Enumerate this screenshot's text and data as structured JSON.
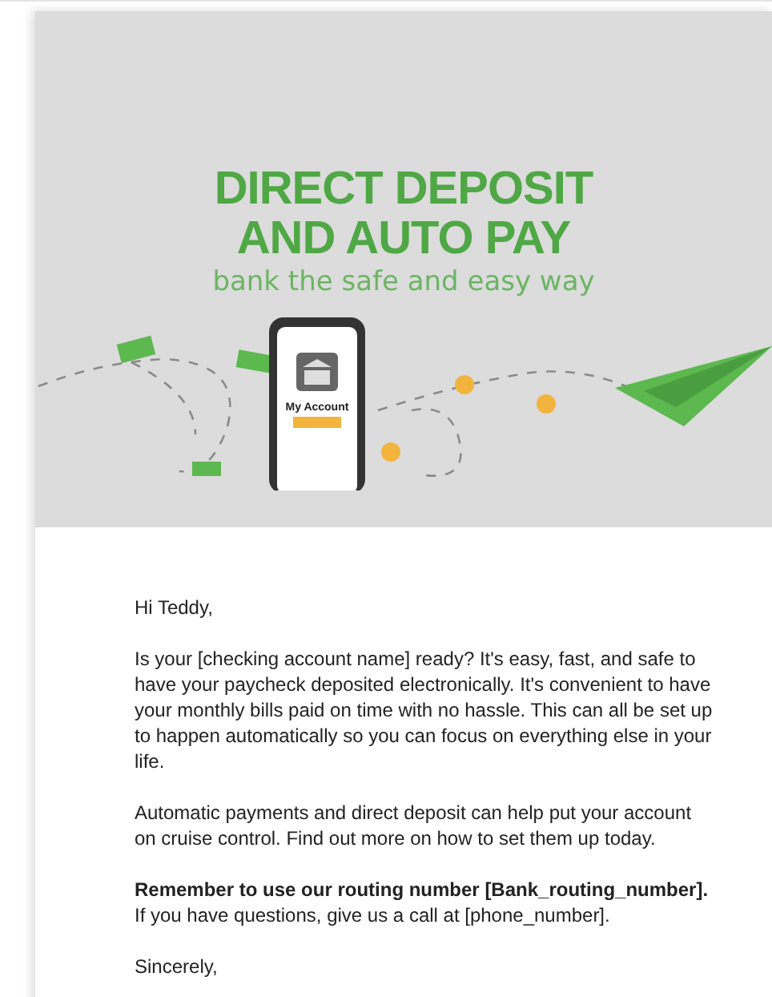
{
  "hero": {
    "title_lines": [
      "DIRECT DEPOSIT",
      "AND AUTO PAY"
    ],
    "tagline": "bank the safe and easy way",
    "phone_label": "My Account"
  },
  "email": {
    "greeting": "Hi Teddy,",
    "paragraphs": [
      {
        "kind": "plain",
        "text": "Is your [checking account name] ready? It's easy, fast, and safe to have your paycheck deposited electronically. It's convenient to have your monthly bills paid on time with no hassle. This can all be set up to happen automatically so you can focus on everything else in your life."
      },
      {
        "kind": "plain",
        "text": "Automatic payments and direct deposit can help put your account on cruise control. Find out more on how to set them up today."
      },
      {
        "kind": "lead",
        "lead": "Remember to use our routing number [Bank_routing_number].",
        "text": "If you have questions, give us a call at [phone_number]."
      }
    ],
    "closing": "Sincerely,"
  }
}
